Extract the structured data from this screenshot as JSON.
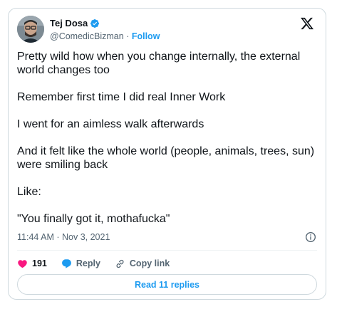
{
  "tweet": {
    "author_name": "Tej Dosa",
    "handle": "@ComedicBizman",
    "separator": "·",
    "follow_label": "Follow",
    "paragraphs": [
      "Pretty wild how when you change internally, the external world changes too",
      "Remember first time I did real Inner Work",
      "I went for an aimless walk afterwards",
      "And it felt like the whole world (people, animals, trees, sun) were smiling back",
      "Like:",
      "\"You finally got it, mothafucka\""
    ],
    "timestamp": "11:44 AM · Nov 3, 2021",
    "likes_count": "191",
    "reply_label": "Reply",
    "copy_link_label": "Copy link",
    "read_replies_label": "Read 11 replies"
  },
  "icons": {
    "verified": "verified-badge-icon",
    "platform": "x-logo-icon",
    "info": "info-icon",
    "like": "heart-icon",
    "reply": "speech-bubble-icon",
    "copy_link": "link-icon"
  },
  "colors": {
    "accent": "#1d9bf0",
    "like": "#f91880",
    "text": "#0f1419",
    "muted": "#536471",
    "border": "#cfd9de"
  }
}
